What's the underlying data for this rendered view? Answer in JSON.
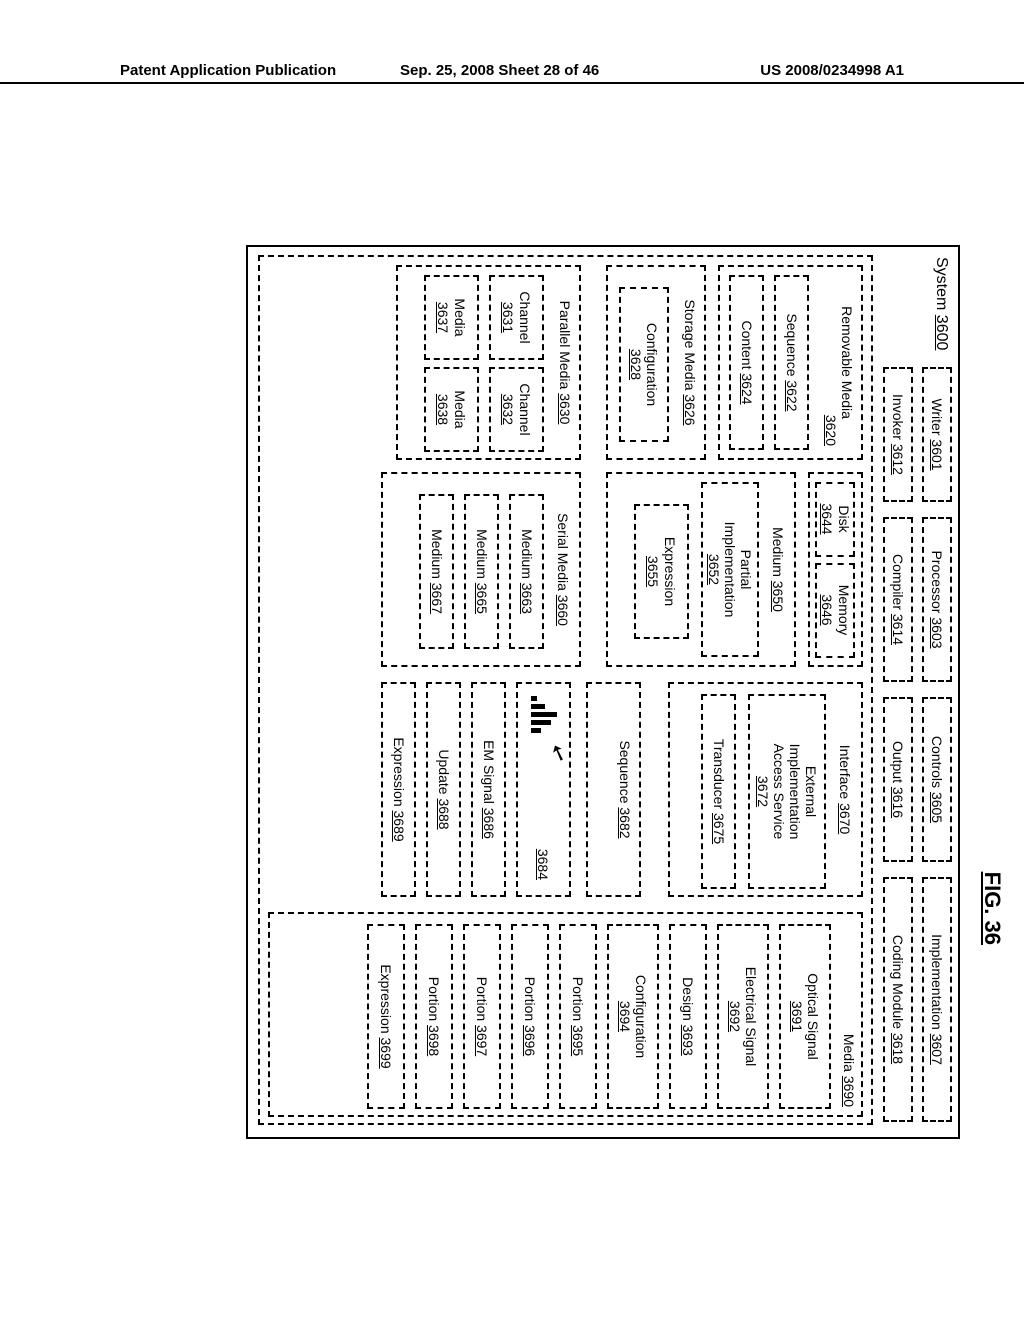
{
  "header": {
    "left": "Patent Application Publication",
    "middle": "Sep. 25, 2008  Sheet 28 of 46",
    "right": "US 2008/0234998 A1"
  },
  "figlabel": "FIG. 36",
  "system": {
    "label": "System",
    "num": "3600"
  },
  "row1": [
    {
      "label": "Writer",
      "num": "3601"
    },
    {
      "label": "Processor",
      "num": "3603"
    },
    {
      "label": "Controls",
      "num": "3605"
    },
    {
      "label": "Implementation",
      "num": "3607"
    }
  ],
  "row2": [
    {
      "label": "Invoker",
      "num": "3612"
    },
    {
      "label": "Compiler",
      "num": "3614"
    },
    {
      "label": "Output",
      "num": "3616"
    },
    {
      "label": "Coding Module",
      "num": "3618"
    }
  ],
  "big": {
    "removable": {
      "label": "Removable Media",
      "num": "3620",
      "items": [
        {
          "label": "Sequence",
          "num": "3622"
        },
        {
          "label": "Content",
          "num": "3624"
        }
      ]
    },
    "dm": {
      "disk": {
        "label": "Disk",
        "num": "3644"
      },
      "memory": {
        "label": "Memory",
        "num": "3646"
      }
    },
    "medium50": {
      "label": "Medium",
      "num": "3650",
      "items": [
        {
          "label": "Partial Implementation",
          "num": "3652"
        },
        {
          "label": "Expression",
          "num": "3655"
        }
      ]
    },
    "storage": {
      "label": "Storage Media",
      "num": "3626",
      "items": [
        {
          "label": "Configuration",
          "num": "3628"
        }
      ]
    },
    "parallel": {
      "label": "Parallel Media",
      "num": "3630",
      "items": [
        {
          "label": "Channel",
          "num": "3631"
        },
        {
          "label": "Channel",
          "num": "3632"
        },
        {
          "label": "Media",
          "num": "3637"
        },
        {
          "label": "Media",
          "num": "3638"
        }
      ]
    },
    "serial": {
      "label": "Serial Media",
      "num": "3660",
      "items": [
        {
          "label": "Medium",
          "num": "3663"
        },
        {
          "label": "Medium",
          "num": "3665"
        },
        {
          "label": "Medium",
          "num": "3667"
        }
      ]
    },
    "interface": {
      "label": "Interface",
      "num": "3670",
      "items": [
        {
          "label": "External Implementation Access Service",
          "num": "3672"
        },
        {
          "label": "Transducer",
          "num": "3675"
        }
      ]
    },
    "col3items": [
      {
        "label": "Sequence",
        "num": "3682"
      },
      {
        "label": "",
        "num": "3684"
      },
      {
        "label": "EM Signal",
        "num": "3686"
      },
      {
        "label": "Update",
        "num": "3688"
      },
      {
        "label": "Expression",
        "num": "3689"
      }
    ],
    "media90": {
      "label": "Media",
      "num": "3690",
      "items": [
        {
          "label": "Optical Signal",
          "num": "3691"
        },
        {
          "label": "Electrical Signal",
          "num": "3692"
        },
        {
          "label": "Design",
          "num": "3693"
        },
        {
          "label": "Configuration",
          "num": "3694"
        },
        {
          "label": "Portion",
          "num": "3695"
        },
        {
          "label": "Portion",
          "num": "3696"
        },
        {
          "label": "Portion",
          "num": "3697"
        },
        {
          "label": "Portion",
          "num": "3698"
        },
        {
          "label": "Expression",
          "num": "3699"
        }
      ]
    }
  }
}
